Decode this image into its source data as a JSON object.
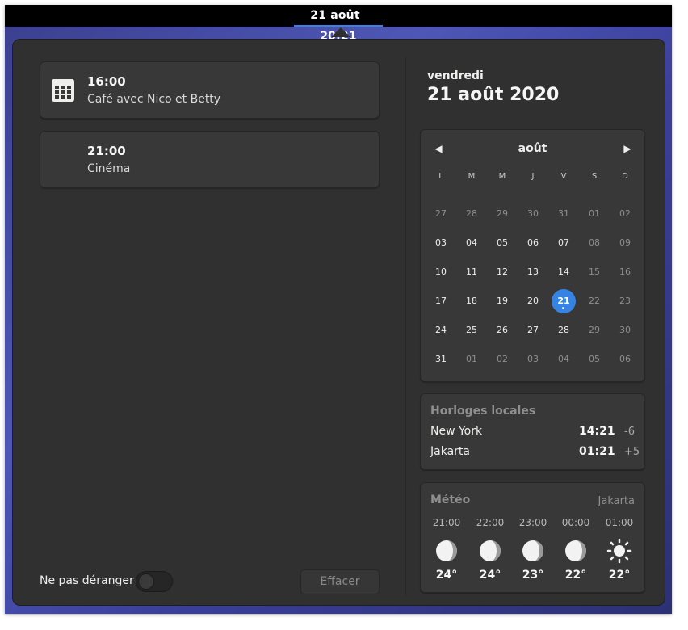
{
  "topbar": {
    "date": "21 août",
    "time": "20:21"
  },
  "events": [
    {
      "time": "16:00",
      "title": "Café avec Nico et Betty"
    },
    {
      "time": "21:00",
      "title": "Cinéma"
    }
  ],
  "footer": {
    "dnd_label": "Ne pas déranger",
    "dnd_enabled": false,
    "clear_label": "Effacer"
  },
  "date_header": {
    "day": "vendredi",
    "date": "21 août 2020"
  },
  "calendar": {
    "month": "août",
    "weekdays": [
      "L",
      "M",
      "M",
      "J",
      "V",
      "S",
      "D"
    ],
    "weeks": [
      [
        "27",
        "28",
        "29",
        "30",
        "31",
        "01",
        "02"
      ],
      [
        "03",
        "04",
        "05",
        "06",
        "07",
        "08",
        "09"
      ],
      [
        "10",
        "11",
        "12",
        "13",
        "14",
        "15",
        "16"
      ],
      [
        "17",
        "18",
        "19",
        "20",
        "21",
        "22",
        "23"
      ],
      [
        "24",
        "25",
        "26",
        "27",
        "28",
        "29",
        "30"
      ],
      [
        "31",
        "01",
        "02",
        "03",
        "04",
        "05",
        "06"
      ]
    ],
    "today": "21"
  },
  "world_clocks": {
    "title": "Horloges locales",
    "items": [
      {
        "city": "New York",
        "time": "14:21",
        "offset": "-6"
      },
      {
        "city": "Jakarta",
        "time": "01:21",
        "offset": "+5"
      }
    ]
  },
  "weather": {
    "title": "Météo",
    "location": "Jakarta",
    "forecast": [
      {
        "hour": "21:00",
        "icon": "moon-icon",
        "temp": "24°"
      },
      {
        "hour": "22:00",
        "icon": "moon-icon",
        "temp": "24°"
      },
      {
        "hour": "23:00",
        "icon": "moon-icon",
        "temp": "23°"
      },
      {
        "hour": "00:00",
        "icon": "moon-icon",
        "temp": "22°"
      },
      {
        "hour": "01:00",
        "icon": "sun-icon",
        "temp": "22°"
      }
    ]
  },
  "colors": {
    "accent": "#3584e4",
    "panel": "#303030",
    "card": "#383838"
  }
}
